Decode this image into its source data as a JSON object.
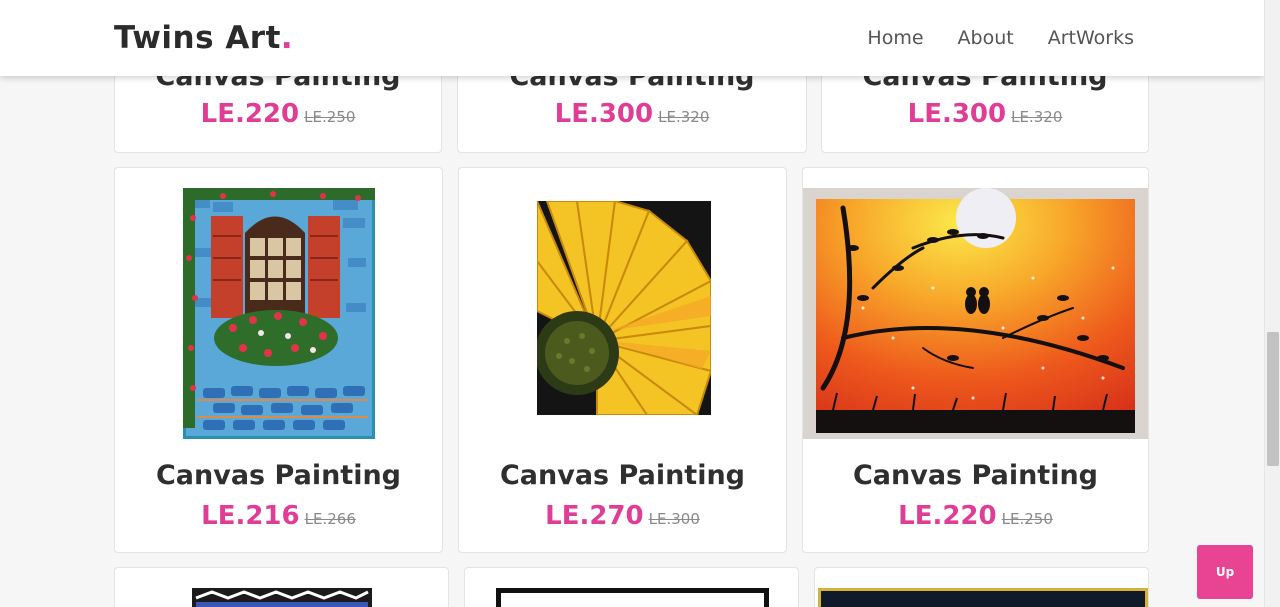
{
  "brand": {
    "name": "Twins Art",
    "dot": "."
  },
  "nav": [
    {
      "label": "Home"
    },
    {
      "label": "About"
    },
    {
      "label": "ArtWorks"
    }
  ],
  "top_row": [
    {
      "title": "Canvas Painting",
      "price": "LE.220",
      "old_price": "LE.250"
    },
    {
      "title": "Canvas Painting",
      "price": "LE.300",
      "old_price": "LE.320"
    },
    {
      "title": "Canvas Painting",
      "price": "LE.300",
      "old_price": "LE.320"
    }
  ],
  "middle_row": [
    {
      "title": "Canvas Painting",
      "price": "LE.216",
      "old_price": "LE.266",
      "image": "window-painting"
    },
    {
      "title": "Canvas Painting",
      "price": "LE.270",
      "old_price": "LE.300",
      "image": "sunflower-painting"
    },
    {
      "title": "Canvas Painting",
      "price": "LE.220",
      "old_price": "LE.250",
      "image": "sunset-birds-painting"
    }
  ],
  "up_button": {
    "label": "Up"
  },
  "colors": {
    "accent": "#e03d96",
    "up_button": "#e94394"
  }
}
